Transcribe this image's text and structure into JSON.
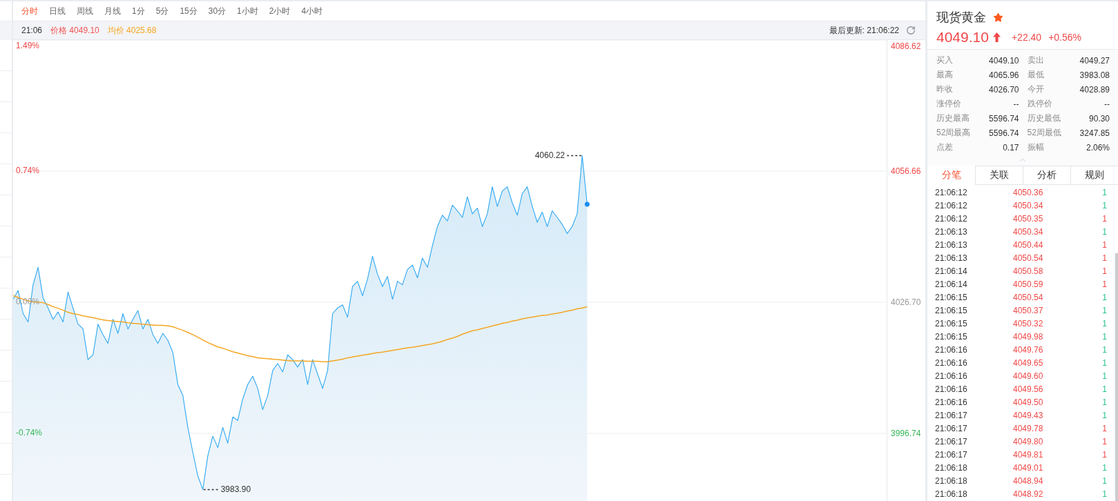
{
  "period_tabs": [
    {
      "label": "分时",
      "selected": true
    },
    {
      "label": "日线",
      "selected": false
    },
    {
      "label": "周线",
      "selected": false
    },
    {
      "label": "月线",
      "selected": false
    },
    {
      "label": "1分",
      "selected": false
    },
    {
      "label": "5分",
      "selected": false
    },
    {
      "label": "15分",
      "selected": false
    },
    {
      "label": "30分",
      "selected": false
    },
    {
      "label": "1小时",
      "selected": false
    },
    {
      "label": "2小时",
      "selected": false
    },
    {
      "label": "4小时",
      "selected": false
    }
  ],
  "info_bar": {
    "time": "21:06",
    "legend": [
      {
        "text": "价格 4049.10",
        "color": "#f25454"
      },
      {
        "text": "均价 4025.68",
        "color": "#f5a623"
      }
    ],
    "last_update": "最后更新: 21:06:22"
  },
  "chart": {
    "percent_labels": [
      {
        "text": "1.49%",
        "color": "#f04848"
      },
      {
        "text": "0.74%",
        "color": "#f04848"
      },
      {
        "text": "0.00%",
        "color": "#999999"
      },
      {
        "text": "-0.74%",
        "color": "#35b558"
      }
    ],
    "chart_data": {
      "type": "area",
      "grid": true,
      "ylim": [
        3981.29,
        4086.62
      ],
      "yticks": [
        {
          "value": 4086.62,
          "label": "4086.62"
        },
        {
          "value": 4056.66,
          "label": "4056.66"
        },
        {
          "value": 4026.7,
          "label": "4026.70"
        },
        {
          "value": 3996.74,
          "label": "3996.74"
        }
      ],
      "series": [
        {
          "color": "#2ea8f2",
          "values": [
            4027.4,
            4029.4,
            4024.1,
            4022.2,
            4030.7,
            4034.7,
            4027.7,
            4025.4,
            4022.8,
            4024.5,
            4022.2,
            4029.0,
            4025.4,
            4021.7,
            4020.6,
            4013.6,
            4014.7,
            4021.7,
            4019.3,
            4017.3,
            4022.8,
            4019.6,
            4024.1,
            4020.6,
            4022.8,
            4024.8,
            4020.6,
            4022.8,
            4019.3,
            4017.3,
            4019.6,
            4018.0,
            4015.2,
            4007.9,
            4005.4,
            3998.1,
            3992.4,
            3987.0,
            3983.9,
            3991.6,
            3996.1,
            3993.5,
            3998.1,
            3994.5,
            4000.5,
            3999.7,
            4004.6,
            4007.9,
            4009.8,
            4007.0,
            4002.2,
            4005.4,
            4011.1,
            4012.7,
            4010.8,
            4014.7,
            4013.6,
            4011.9,
            4013.6,
            4007.9,
            4013.6,
            4010.3,
            4007.0,
            4011.1,
            4024.1,
            4025.4,
            4026.1,
            4023.3,
            4030.3,
            4031.5,
            4028.2,
            4032.0,
            4037.2,
            4033.1,
            4030.3,
            4032.6,
            4027.4,
            4031.5,
            4030.7,
            4034.2,
            4035.2,
            4032.3,
            4036.8,
            4034.7,
            4039.6,
            4044.0,
            4046.6,
            4045.3,
            4048.9,
            4047.6,
            4046.1,
            4050.8,
            4046.9,
            4048.2,
            4044.0,
            4046.9,
            4053.1,
            4048.6,
            4052.1,
            4053.1,
            4049.4,
            4046.6,
            4051.5,
            4053.1,
            4048.6,
            4045.0,
            4047.3,
            4044.0,
            4047.6,
            4046.1,
            4044.5,
            4042.4,
            4044.0,
            4046.9,
            4060.2,
            4049.1,
            null,
            null,
            null,
            null,
            null,
            null,
            null,
            null,
            null,
            null,
            null,
            null,
            null,
            null,
            null,
            null,
            null,
            null,
            null,
            null,
            null,
            null,
            null,
            null,
            null,
            null,
            null,
            null,
            null,
            null,
            null,
            null,
            null,
            null,
            null,
            null,
            null,
            null,
            null,
            null,
            null,
            null,
            null,
            null,
            null,
            null,
            null,
            null,
            null,
            null,
            null,
            null,
            null,
            null,
            null,
            null,
            null,
            null,
            null,
            null
          ]
        },
        {
          "type": "line",
          "color": "#f5a623",
          "values": [
            4028.2,
            4027.8,
            4027.4,
            4027.0,
            4026.8,
            4026.7,
            4026.6,
            4026.2,
            4025.7,
            4025.3,
            4024.9,
            4024.4,
            4024.1,
            4023.9,
            4023.6,
            4023.4,
            4023.2,
            4022.9,
            4022.7,
            4022.5,
            4022.4,
            4022.3,
            4022.2,
            4022.0,
            4021.9,
            4021.8,
            4021.7,
            4021.6,
            4021.5,
            4021.4,
            4021.4,
            4021.3,
            4021.1,
            4020.7,
            4020.3,
            4019.8,
            4019.3,
            4018.7,
            4018.1,
            4017.5,
            4017.0,
            4016.5,
            4016.2,
            4015.8,
            4015.4,
            4015.1,
            4014.8,
            4014.5,
            4014.3,
            4014.0,
            4013.9,
            4013.8,
            4013.7,
            4013.6,
            4013.5,
            4013.4,
            4013.3,
            4013.3,
            4013.3,
            4013.2,
            4013.2,
            4013.2,
            4013.1,
            4013.1,
            4013.3,
            4013.5,
            4013.7,
            4014.0,
            4014.2,
            4014.4,
            4014.6,
            4014.8,
            4015.0,
            4015.2,
            4015.3,
            4015.5,
            4015.7,
            4015.9,
            4016.1,
            4016.3,
            4016.4,
            4016.6,
            4016.8,
            4017.0,
            4017.2,
            4017.5,
            4017.8,
            4018.2,
            4018.5,
            4018.9,
            4019.4,
            4019.8,
            4020.2,
            4020.4,
            4020.7,
            4021.0,
            4021.3,
            4021.6,
            4021.9,
            4022.1,
            4022.4,
            4022.6,
            4022.9,
            4023.1,
            4023.3,
            4023.5,
            4023.7,
            4023.8,
            4024.0,
            4024.2,
            4024.4,
            4024.7,
            4024.9,
            4025.2,
            4025.4,
            4025.7,
            null,
            null,
            null,
            null,
            null,
            null,
            null,
            null,
            null,
            null,
            null,
            null,
            null,
            null,
            null,
            null,
            null,
            null,
            null,
            null,
            null,
            null,
            null,
            null,
            null,
            null,
            null,
            null,
            null,
            null,
            null,
            null,
            null,
            null,
            null,
            null,
            null,
            null,
            null,
            null,
            null,
            null,
            null,
            null,
            null,
            null,
            null,
            null,
            null,
            null,
            null,
            null,
            null,
            null,
            null,
            null,
            null,
            null,
            null,
            null
          ]
        }
      ],
      "annotations": [
        "4060.22",
        "3983.90"
      ]
    }
  },
  "quote": {
    "name": "现货黄金",
    "favorite": true,
    "price": "4049.10",
    "rising": true,
    "change": "+22.40",
    "change_pct": "+0.56%",
    "stats": [
      {
        "label": "买入",
        "value": "4049.10"
      },
      {
        "label": "卖出",
        "value": "4049.27"
      },
      {
        "label": "最高",
        "value": "4065.96"
      },
      {
        "label": "最低",
        "value": "3983.08"
      },
      {
        "label": "昨收",
        "value": "4026.70"
      },
      {
        "label": "今开",
        "value": "4028.89"
      },
      {
        "label": "涨停价",
        "value": "--"
      },
      {
        "label": "跌停价",
        "value": "--"
      },
      {
        "label": "历史最高",
        "value": "5596.74"
      },
      {
        "label": "历史最低",
        "value": "90.30"
      },
      {
        "label": "52周最高",
        "value": "5596.74"
      },
      {
        "label": "52周最低",
        "value": "3247.85"
      },
      {
        "label": "点差",
        "value": "0.17"
      },
      {
        "label": "振幅",
        "value": "2.06%"
      }
    ]
  },
  "detail_tabs": [
    {
      "label": "分笔",
      "selected": true
    },
    {
      "label": "关联",
      "selected": false
    },
    {
      "label": "分析",
      "selected": false
    },
    {
      "label": "规则",
      "selected": false
    }
  ],
  "ticks": [
    {
      "time": "21:06:12",
      "price": "4050.36",
      "volume": "1",
      "uptick": false
    },
    {
      "time": "21:06:12",
      "price": "4050.34",
      "volume": "1",
      "uptick": false
    },
    {
      "time": "21:06:12",
      "price": "4050.35",
      "volume": "1",
      "uptick": true
    },
    {
      "time": "21:06:13",
      "price": "4050.34",
      "volume": "1",
      "uptick": false
    },
    {
      "time": "21:06:13",
      "price": "4050.44",
      "volume": "1",
      "uptick": true
    },
    {
      "time": "21:06:13",
      "price": "4050.54",
      "volume": "1",
      "uptick": true
    },
    {
      "time": "21:06:14",
      "price": "4050.58",
      "volume": "1",
      "uptick": true
    },
    {
      "time": "21:06:14",
      "price": "4050.59",
      "volume": "1",
      "uptick": true
    },
    {
      "time": "21:06:15",
      "price": "4050.54",
      "volume": "1",
      "uptick": false
    },
    {
      "time": "21:06:15",
      "price": "4050.37",
      "volume": "1",
      "uptick": false
    },
    {
      "time": "21:06:15",
      "price": "4050.32",
      "volume": "1",
      "uptick": false
    },
    {
      "time": "21:06:15",
      "price": "4049.98",
      "volume": "1",
      "uptick": false
    },
    {
      "time": "21:06:16",
      "price": "4049.76",
      "volume": "1",
      "uptick": false
    },
    {
      "time": "21:06:16",
      "price": "4049.65",
      "volume": "1",
      "uptick": false
    },
    {
      "time": "21:06:16",
      "price": "4049.60",
      "volume": "1",
      "uptick": false
    },
    {
      "time": "21:06:16",
      "price": "4049.56",
      "volume": "1",
      "uptick": false
    },
    {
      "time": "21:06:16",
      "price": "4049.50",
      "volume": "1",
      "uptick": false
    },
    {
      "time": "21:06:17",
      "price": "4049.43",
      "volume": "1",
      "uptick": false
    },
    {
      "time": "21:06:17",
      "price": "4049.78",
      "volume": "1",
      "uptick": true
    },
    {
      "time": "21:06:17",
      "price": "4049.80",
      "volume": "1",
      "uptick": true
    },
    {
      "time": "21:06:17",
      "price": "4049.81",
      "volume": "1",
      "uptick": true
    },
    {
      "time": "21:06:18",
      "price": "4049.01",
      "volume": "1",
      "uptick": false
    },
    {
      "time": "21:06:18",
      "price": "4048.94",
      "volume": "1",
      "uptick": false
    },
    {
      "time": "21:06:18",
      "price": "4048.92",
      "volume": "1",
      "uptick": false
    }
  ]
}
